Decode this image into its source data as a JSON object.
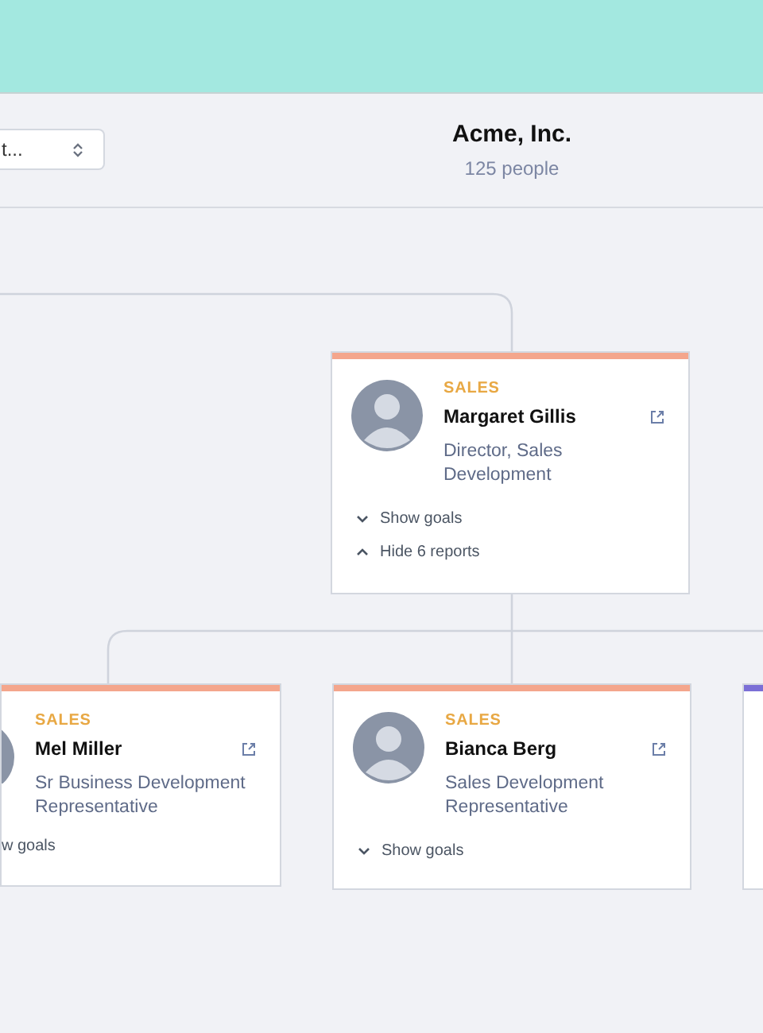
{
  "toolbar": {
    "select": {
      "value": "t..."
    },
    "org": {
      "name": "Acme, Inc.",
      "count": "125 people"
    }
  },
  "cards": [
    {
      "kind": "full",
      "department": "SALES",
      "name": "Margaret Gillis",
      "title": "Director, Sales Development",
      "color": "#f4a68c",
      "actions": [
        {
          "label": "Show goals",
          "expanded": false
        },
        {
          "label": "Hide 6 reports",
          "expanded": true
        }
      ]
    },
    {
      "kind": "cut-left",
      "department": "SALES",
      "name": "Mel Miller",
      "title": "Sr Business Development Representative",
      "color": "#f4a68c",
      "actions": [
        {
          "label": "w goals"
        }
      ]
    },
    {
      "kind": "full",
      "department": "SALES",
      "name": "Bianca Berg",
      "title": "Sales Development Representative",
      "color": "#f4a68c",
      "actions": [
        {
          "label": "Show goals",
          "expanded": false
        }
      ]
    },
    {
      "kind": "stub",
      "color": "#7b6fd6"
    }
  ]
}
